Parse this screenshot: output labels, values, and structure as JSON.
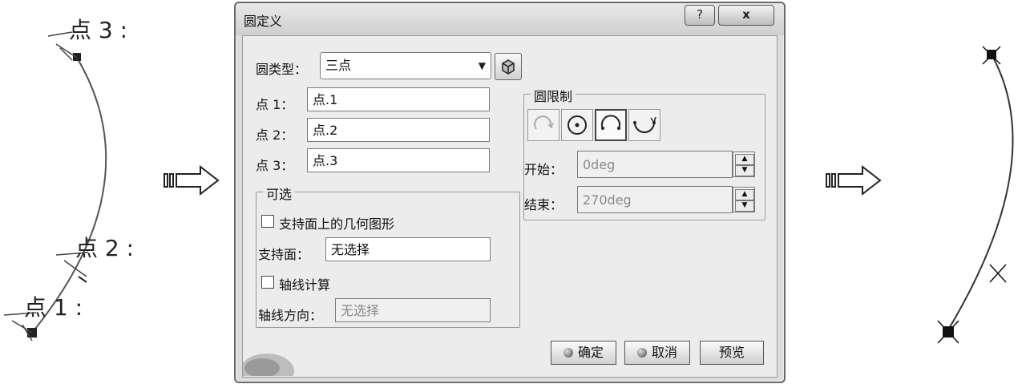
{
  "left_sketch": {
    "labels": [
      "点 3 :",
      "点 2 :",
      "点 1 :"
    ]
  },
  "dialog": {
    "title": "圆定义",
    "help_button": "?",
    "close_button": "x",
    "circle_type_label": "圆类型：",
    "circle_type_value": "三点",
    "point1_label": "点 1：",
    "point1_value": "点.1",
    "point2_label": "点 2：",
    "point2_value": "点.2",
    "point3_label": "点 3：",
    "point3_value": "点.3",
    "optional_group": {
      "title": "可选",
      "support_geometry_checkbox": "支持面上的几何图形",
      "support_label": "支持面：",
      "support_value": "无选择",
      "axis_compute_checkbox": "轴线计算",
      "axis_direction_label": "轴线方向：",
      "axis_direction_value": "无选择"
    },
    "limit_group": {
      "title": "圆限制",
      "start_label": "开始：",
      "start_value": "0deg",
      "end_label": "结束：",
      "end_value": "270deg"
    },
    "ok_button": "确定",
    "cancel_button": "取消",
    "preview_button": "预览"
  },
  "colors": {
    "dialog_bg": "#ececec",
    "line": "#333333"
  }
}
